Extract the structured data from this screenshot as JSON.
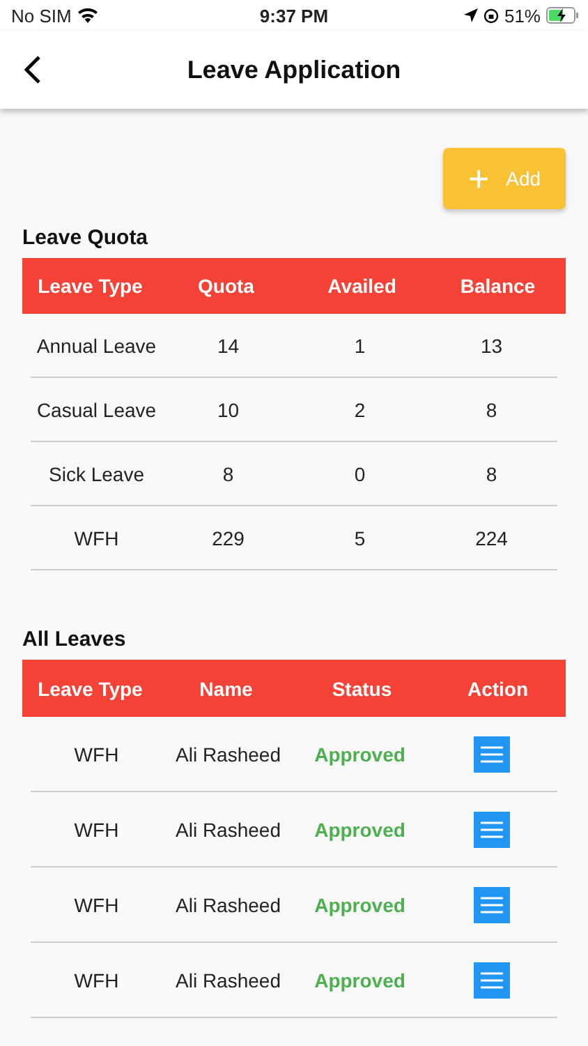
{
  "status_bar": {
    "carrier": "No SIM",
    "time": "9:37 PM",
    "battery": "51%"
  },
  "header": {
    "title": "Leave Application"
  },
  "add_button": {
    "label": "Add",
    "icon": "+"
  },
  "leave_quota": {
    "title": "Leave Quota",
    "columns": [
      "Leave Type",
      "Quota",
      "Availed",
      "Balance"
    ],
    "rows": [
      [
        "Annual Leave",
        "14",
        "1",
        "13"
      ],
      [
        "Casual Leave",
        "10",
        "2",
        "8"
      ],
      [
        "Sick Leave",
        "8",
        "0",
        "8"
      ],
      [
        "WFH",
        "229",
        "5",
        "224"
      ]
    ]
  },
  "all_leaves": {
    "title": "All Leaves",
    "columns": [
      "Leave Type",
      "Name",
      "Status",
      "Action"
    ],
    "rows": [
      {
        "type": "WFH",
        "name": "Ali Rasheed",
        "status": "Approved",
        "color": "#4caf50"
      },
      {
        "type": "WFH",
        "name": "Ali Rasheed",
        "status": "Approved",
        "color": "#4caf50"
      },
      {
        "type": "WFH",
        "name": "Ali Rasheed",
        "status": "Approved",
        "color": "#4caf50"
      },
      {
        "type": "WFH",
        "name": "Ali Rasheed",
        "status": "Approved",
        "color": "#4caf50"
      }
    ]
  }
}
